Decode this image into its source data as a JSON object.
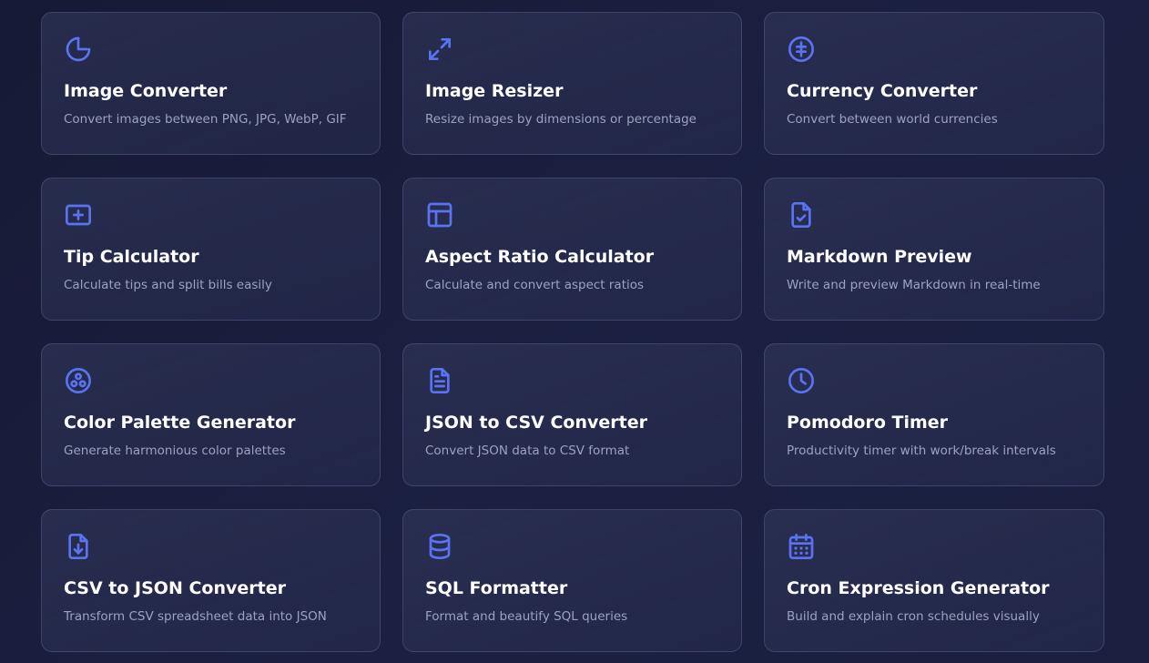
{
  "colors": {
    "accent": "#5b73f2",
    "title": "#ffffff",
    "description": "#9aa3c0"
  },
  "tools": [
    {
      "id": "image-converter",
      "icon": "refresh-half-circle-icon",
      "title": "Image Converter",
      "description": "Convert images between PNG, JPG, WebP, GIF"
    },
    {
      "id": "image-resizer",
      "icon": "expand-arrows-icon",
      "title": "Image Resizer",
      "description": "Resize images by dimensions or percentage"
    },
    {
      "id": "currency-converter",
      "icon": "currency-coin-icon",
      "title": "Currency Converter",
      "description": "Convert between world currencies"
    },
    {
      "id": "tip-calculator",
      "icon": "plus-box-icon",
      "title": "Tip Calculator",
      "description": "Calculate tips and split bills easily"
    },
    {
      "id": "aspect-ratio-calculator",
      "icon": "layout-grid-icon",
      "title": "Aspect Ratio Calculator",
      "description": "Calculate and convert aspect ratios"
    },
    {
      "id": "markdown-preview",
      "icon": "file-check-icon",
      "title": "Markdown Preview",
      "description": "Write and preview Markdown in real-time"
    },
    {
      "id": "color-palette-generator",
      "icon": "palette-circles-icon",
      "title": "Color Palette Generator",
      "description": "Generate harmonious color palettes"
    },
    {
      "id": "json-to-csv-converter",
      "icon": "file-text-icon",
      "title": "JSON to CSV Converter",
      "description": "Convert JSON data to CSV format"
    },
    {
      "id": "pomodoro-timer",
      "icon": "clock-icon",
      "title": "Pomodoro Timer",
      "description": "Productivity timer with work/break intervals"
    },
    {
      "id": "csv-to-json-converter",
      "icon": "file-download-icon",
      "title": "CSV to JSON Converter",
      "description": "Transform CSV spreadsheet data into JSON"
    },
    {
      "id": "sql-formatter",
      "icon": "database-icon",
      "title": "SQL Formatter",
      "description": "Format and beautify SQL queries"
    },
    {
      "id": "cron-expression-generator",
      "icon": "calendar-icon",
      "title": "Cron Expression Generator",
      "description": "Build and explain cron schedules visually"
    }
  ]
}
